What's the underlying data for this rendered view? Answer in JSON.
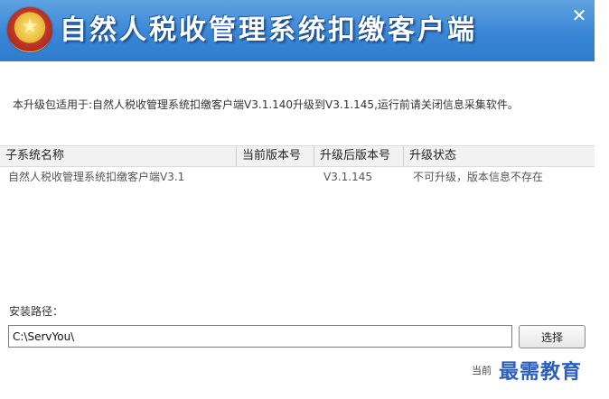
{
  "window": {
    "title": "自然人税收管理系统扣缴客户端",
    "close_symbol": "✕"
  },
  "notice": "本升级包适用于:自然人税收管理系统扣缴客户端V3.1.140升级到V3.1.145,运行前请关闭信息采集软件。",
  "table": {
    "headers": [
      "子系统名称",
      "当前版本号",
      "升级后版本号",
      "升级状态"
    ],
    "rows": [
      {
        "name": "自然人税收管理系统扣缴客户端V3.1",
        "current_version": "",
        "target_version": "V3.1.145",
        "status": "不可升级，版本信息不存在"
      }
    ]
  },
  "install": {
    "label": "安装路径：",
    "path_value": "C:\\ServYou\\",
    "choose_label": "选择"
  },
  "footer": {
    "version_text": "当前",
    "watermark": "最需教育"
  },
  "colors": {
    "titlebar": "#3a86d6",
    "header_bg": "#f2f2f2"
  }
}
